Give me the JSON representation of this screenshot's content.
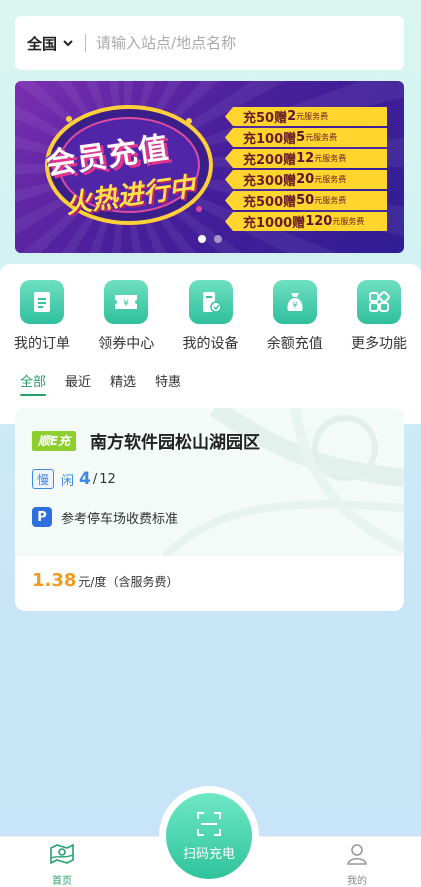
{
  "search": {
    "region": "全国",
    "placeholder": "请输入站点/地点名称"
  },
  "banner": {
    "title": "会员充值",
    "subtitle": "火热进行中",
    "promos": [
      {
        "charge": "充50赠",
        "amount": "2",
        "unit": "元服务费"
      },
      {
        "charge": "充100赠",
        "amount": "5",
        "unit": "元服务费"
      },
      {
        "charge": "充200赠",
        "amount": "12",
        "unit": "元服务费"
      },
      {
        "charge": "充300赠",
        "amount": "20",
        "unit": "元服务费"
      },
      {
        "charge": "充500赠",
        "amount": "50",
        "unit": "元服务费"
      },
      {
        "charge": "充1000赠",
        "amount": "120",
        "unit": "元服务费"
      }
    ],
    "slide_count": 2,
    "active_slide": 1
  },
  "quick_actions": [
    {
      "label": "我的订单",
      "icon": "order-icon"
    },
    {
      "label": "领券中心",
      "icon": "coupon-icon"
    },
    {
      "label": "我的设备",
      "icon": "device-icon"
    },
    {
      "label": "余额充值",
      "icon": "wallet-icon"
    },
    {
      "label": "更多功能",
      "icon": "grid-icon"
    }
  ],
  "filter_tabs": [
    {
      "label": "全部",
      "active": true
    },
    {
      "label": "最近",
      "active": false
    },
    {
      "label": "精选",
      "active": false
    },
    {
      "label": "特惠",
      "active": false
    }
  ],
  "station": {
    "brand": "顺E充",
    "name": "南方软件园松山湖园区",
    "charger_type": "慢",
    "idle_label": "闲",
    "idle": "4",
    "separator": "/",
    "total": "12",
    "parking_icon": "P",
    "parking_text": "参考停车场收费标准",
    "price": "1.38",
    "price_unit": "元/度（含服务费）"
  },
  "tabbar": {
    "home": "首页",
    "scan": "扫码充电",
    "mine": "我的"
  },
  "colors": {
    "accent": "#27a067",
    "price": "#f39a21",
    "slow": "#3d89e8",
    "brand": "#8ccf2e"
  }
}
